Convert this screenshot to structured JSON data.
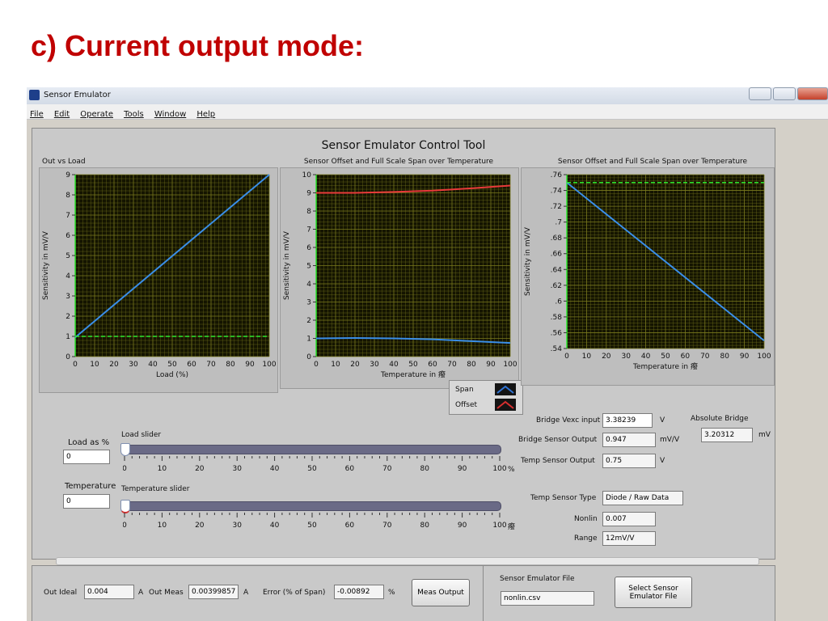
{
  "slide_title": "c) Current output mode:",
  "window": {
    "title": "Sensor Emulator",
    "menu": [
      "File",
      "Edit",
      "Operate",
      "Tools",
      "Window",
      "Help"
    ]
  },
  "panel_title": "Sensor Emulator Control Tool",
  "graphs": {
    "out_vs_load": {
      "title": "Out vs Load",
      "ylabel": "Sensitivity in mV/V",
      "xlabel": "Load (%)"
    },
    "offset_span": {
      "title": "Sensor Offset and Full Scale Span over Temperature",
      "ylabel": "Sensitivity in mV/V",
      "xlabel": "Temperature in 癈"
    },
    "span_only": {
      "title": "Sensor Offset and Full Scale Span over Temperature",
      "ylabel": "Sensitivity in mV/V",
      "xlabel": "Temperature in 癈"
    }
  },
  "legend": {
    "span": "Span",
    "offset": "Offset"
  },
  "colors": {
    "plot_bg": "#141400",
    "grid": "#7a7a1e",
    "blue_trace": "#3a8ee8",
    "red_trace": "#e83a3a",
    "green_dash": "#2ee82e",
    "legend_blue": "#2f74d6",
    "legend_red": "#d62f2f"
  },
  "controls": {
    "load_label": "Load as %",
    "load_value": "0",
    "load_slider_label": "Load slider",
    "temp_label": "Temperature",
    "temp_value": "0",
    "temp_slider_label": "Temperature slider",
    "slider_scale": [
      "0",
      "10",
      "20",
      "30",
      "40",
      "50",
      "60",
      "70",
      "80",
      "90",
      "100"
    ],
    "load_unit": "%",
    "temp_unit": "癈",
    "load_slider_value": 0,
    "temp_slider_value": 0
  },
  "readouts": {
    "bridge_vexc_label": "Bridge Vexc input",
    "bridge_vexc_value": "3.38239",
    "bridge_vexc_unit": "V",
    "abs_bridge_label": "Absolute Bridge",
    "abs_bridge_value": "3.20312",
    "abs_bridge_unit": "mV",
    "bridge_sensor_label": "Bridge Sensor Output",
    "bridge_sensor_value": "0.947",
    "bridge_sensor_unit": "mV/V",
    "temp_sensor_label": "Temp Sensor Output",
    "temp_sensor_value": "0.75",
    "temp_sensor_unit": "V",
    "temp_type_label": "Temp Sensor Type",
    "temp_type_value": "Diode / Raw Data",
    "nonlin_label": "Nonlin",
    "nonlin_value": "0.007",
    "range_label": "Range",
    "range_value": "12mV/V"
  },
  "bottom": {
    "out_ideal_label": "Out Ideal",
    "out_ideal_value": "0.004",
    "out_ideal_unit": "A",
    "out_meas_label": "Out Meas",
    "out_meas_value": "0.00399857",
    "out_meas_unit": "A",
    "error_label": "Error (% of Span)",
    "error_value": "-0.00892",
    "error_unit": "%",
    "meas_button": "Meas Output",
    "file_label": "Sensor Emulator File",
    "file_value": "nonlin.csv",
    "select_button_line1": "Select Sensor",
    "select_button_line2": "Emulator File"
  },
  "chart_data": [
    {
      "type": "line",
      "title": "Out vs Load",
      "xlabel": "Load (%)",
      "ylabel": "Sensitivity in mV/V",
      "xlim": [
        0,
        100
      ],
      "ylim": [
        0,
        9
      ],
      "xticks": [
        0,
        10,
        20,
        30,
        40,
        50,
        60,
        70,
        80,
        90,
        100
      ],
      "yticks": [
        0,
        1,
        2,
        3,
        4,
        5,
        6,
        7,
        8,
        9
      ],
      "grid": true,
      "series": [
        {
          "color": "blue",
          "x": [
            0,
            100
          ],
          "y": [
            0.95,
            9.0
          ]
        },
        {
          "color": "green-dashed",
          "x": [
            0,
            100
          ],
          "y": [
            1.0,
            1.0
          ]
        }
      ]
    },
    {
      "type": "line",
      "title": "Sensor Offset and Full Scale Span over Temperature",
      "xlabel": "Temperature in 癈",
      "ylabel": "Sensitivity in mV/V",
      "xlim": [
        0,
        100
      ],
      "ylim": [
        0,
        10
      ],
      "xticks": [
        0,
        10,
        20,
        30,
        40,
        50,
        60,
        70,
        80,
        90,
        100
      ],
      "yticks": [
        0,
        1,
        2,
        3,
        4,
        5,
        6,
        7,
        8,
        9,
        10
      ],
      "grid": true,
      "series": [
        {
          "name": "Offset",
          "color": "red",
          "x": [
            0,
            20,
            40,
            60,
            80,
            100
          ],
          "y": [
            9.0,
            9.0,
            9.05,
            9.12,
            9.25,
            9.4
          ]
        },
        {
          "name": "Span",
          "color": "blue",
          "x": [
            0,
            20,
            40,
            60,
            80,
            100
          ],
          "y": [
            1.0,
            1.02,
            1.0,
            0.95,
            0.85,
            0.75
          ]
        }
      ]
    },
    {
      "type": "line",
      "title": "Sensor Offset and Full Scale Span over Temperature",
      "xlabel": "Temperature in 癈",
      "ylabel": "Sensitivity in mV/V",
      "xlim": [
        0,
        100
      ],
      "ylim": [
        0.54,
        0.76
      ],
      "xticks": [
        0,
        10,
        20,
        30,
        40,
        50,
        60,
        70,
        80,
        90,
        100
      ],
      "yticks": [
        0.54,
        0.56,
        0.58,
        0.6,
        0.62,
        0.64,
        0.66,
        0.68,
        0.7,
        0.72,
        0.74,
        0.76
      ],
      "grid": true,
      "series": [
        {
          "color": "blue",
          "x": [
            0,
            100
          ],
          "y": [
            0.75,
            0.55
          ]
        },
        {
          "color": "green-dashed",
          "x": [
            0,
            100
          ],
          "y": [
            0.75,
            0.75
          ]
        }
      ]
    }
  ]
}
